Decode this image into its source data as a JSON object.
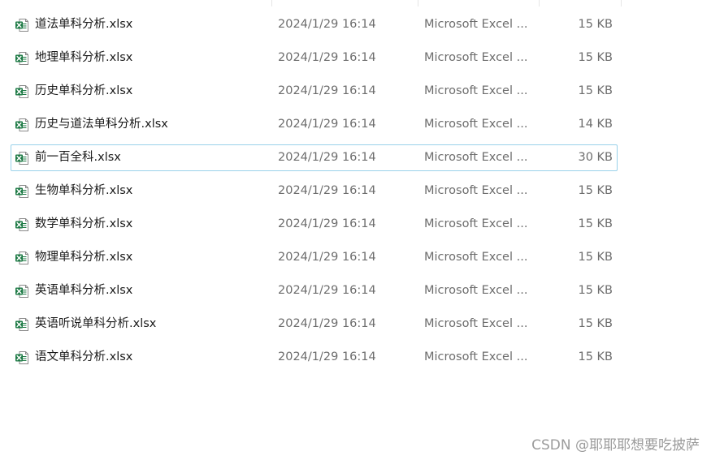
{
  "files": [
    {
      "name": "道法单科分析.xlsx",
      "date": "2024/1/29 16:14",
      "type": "Microsoft Excel ...",
      "size": "15 KB",
      "focused": false
    },
    {
      "name": "地理单科分析.xlsx",
      "date": "2024/1/29 16:14",
      "type": "Microsoft Excel ...",
      "size": "15 KB",
      "focused": false
    },
    {
      "name": "历史单科分析.xlsx",
      "date": "2024/1/29 16:14",
      "type": "Microsoft Excel ...",
      "size": "15 KB",
      "focused": false
    },
    {
      "name": "历史与道法单科分析.xlsx",
      "date": "2024/1/29 16:14",
      "type": "Microsoft Excel ...",
      "size": "14 KB",
      "focused": false
    },
    {
      "name": "前一百全科.xlsx",
      "date": "2024/1/29 16:14",
      "type": "Microsoft Excel ...",
      "size": "30 KB",
      "focused": true
    },
    {
      "name": "生物单科分析.xlsx",
      "date": "2024/1/29 16:14",
      "type": "Microsoft Excel ...",
      "size": "15 KB",
      "focused": false
    },
    {
      "name": "数学单科分析.xlsx",
      "date": "2024/1/29 16:14",
      "type": "Microsoft Excel ...",
      "size": "15 KB",
      "focused": false
    },
    {
      "name": "物理单科分析.xlsx",
      "date": "2024/1/29 16:14",
      "type": "Microsoft Excel ...",
      "size": "15 KB",
      "focused": false
    },
    {
      "name": "英语单科分析.xlsx",
      "date": "2024/1/29 16:14",
      "type": "Microsoft Excel ...",
      "size": "15 KB",
      "focused": false
    },
    {
      "name": "英语听说单科分析.xlsx",
      "date": "2024/1/29 16:14",
      "type": "Microsoft Excel ...",
      "size": "15 KB",
      "focused": false
    },
    {
      "name": "语文单科分析.xlsx",
      "date": "2024/1/29 16:14",
      "type": "Microsoft Excel ...",
      "size": "15 KB",
      "focused": false
    }
  ],
  "icon": "excel-file-icon",
  "colors": {
    "excel_green": "#1d7a45",
    "focus_border": "#99d1ea",
    "secondary_text": "#6d6d6d"
  },
  "watermark": "CSDN @耶耶耶想要吃披萨"
}
